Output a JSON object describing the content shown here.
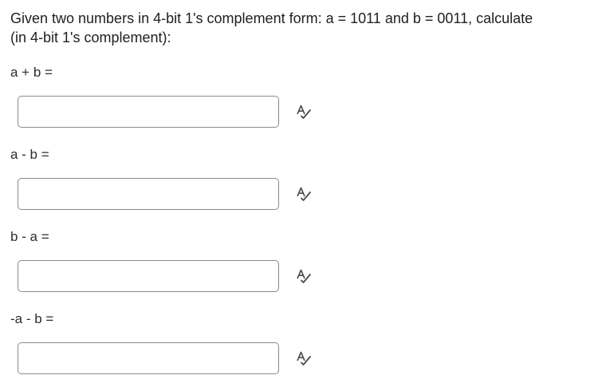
{
  "question": {
    "text_line1": "Given two numbers in 4-bit 1's complement form: a = 1011 and b = 0011, calculate",
    "text_line2": "(in 4-bit 1's complement):"
  },
  "parts": [
    {
      "label": "a + b =",
      "value": ""
    },
    {
      "label": "a - b =",
      "value": ""
    },
    {
      "label": "b - a =",
      "value": ""
    },
    {
      "label": "-a - b =",
      "value": ""
    }
  ],
  "icons": {
    "spellcheck": "spell-check-icon"
  },
  "colors": {
    "border": "#8a8a8a",
    "text": "#202122",
    "icon": "#4a4a4a"
  }
}
